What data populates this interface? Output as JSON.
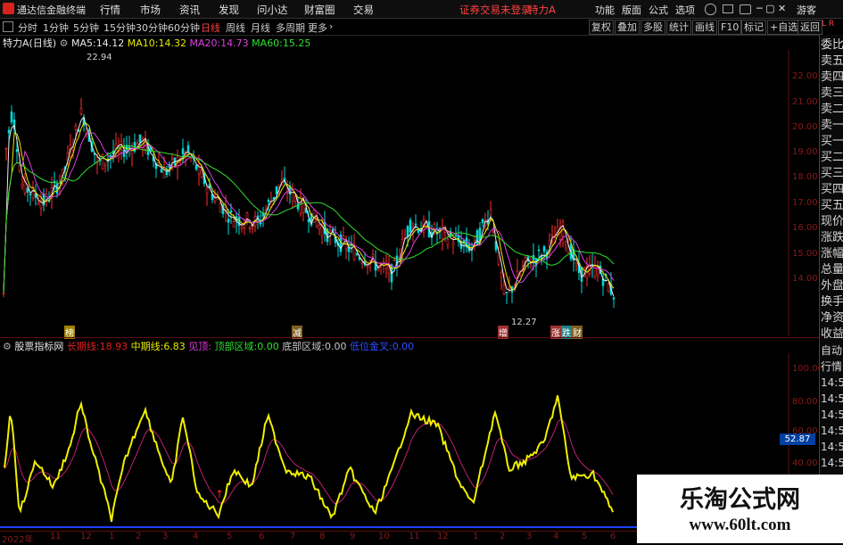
{
  "menubar": {
    "app_title": "通达信金融终端",
    "items": [
      "行情",
      "市场",
      "资讯",
      "发现",
      "问小达",
      "财富圈",
      "交易"
    ],
    "notice": "证券交易未登录",
    "stock_name": "特力A",
    "right_items": [
      "功能",
      "版面",
      "公式",
      "选项"
    ],
    "guest": "游客"
  },
  "toolbar": {
    "periods": [
      "分时",
      "1分钟",
      "5分钟",
      "15分钟",
      "30分钟",
      "60分钟",
      "日线",
      "周线",
      "月线",
      "多周期",
      "更多"
    ],
    "active_period": "日线",
    "right_buttons": [
      "复权",
      "叠加",
      "多股",
      "统计",
      "画线",
      "F10",
      "标记",
      "+自选",
      "返回"
    ]
  },
  "legend_main": {
    "name": "特力A",
    "period": "(日线)",
    "ma": [
      {
        "label": "MA5:",
        "value": "14.12",
        "color": "#e8e8e8"
      },
      {
        "label": "MA10:",
        "value": "14.32",
        "color": "#e8e800"
      },
      {
        "label": "MA20:",
        "value": "14.73",
        "color": "#e040e0"
      },
      {
        "label": "MA60:",
        "value": "15.25",
        "color": "#30e030"
      }
    ]
  },
  "legend_indicator": {
    "name": "股票指标网",
    "items": [
      {
        "label": "长期线:",
        "value": "18.93",
        "color": "#e02020"
      },
      {
        "label": "中期线:",
        "value": "6.83",
        "color": "#e8e800"
      },
      {
        "label": "见顶:",
        "value": "",
        "color": "#e040e0"
      },
      {
        "label": "顶部区域:",
        "value": "0.00",
        "color": "#30e030"
      },
      {
        "label": "底部区域:",
        "value": "0.00",
        "color": "#c8c8c8"
      },
      {
        "label": "低位金叉:",
        "value": "0.00",
        "color": "#3050ff"
      }
    ]
  },
  "price_axis": [
    "22.00",
    "21.00",
    "20.00",
    "19.00",
    "18.00",
    "17.00",
    "16.00",
    "15.00",
    "14.00"
  ],
  "indicator_axis": [
    "100.00",
    "80.00",
    "60.00",
    "40.00"
  ],
  "indicator_current": "52.87",
  "date_axis": [
    "2022年",
    "11",
    "12",
    "1",
    "2",
    "3",
    "4",
    "5",
    "6",
    "7",
    "8",
    "9",
    "10",
    "11",
    "12",
    "1",
    "2",
    "3",
    "4",
    "5",
    "6"
  ],
  "annotations": {
    "high": "22.94",
    "low": "12.27",
    "events": [
      "榜",
      "减",
      "增",
      "涨",
      "跌",
      "财"
    ]
  },
  "sidebar": {
    "top": "L R",
    "items": [
      "委比",
      "卖五",
      "卖四",
      "卖三",
      "卖二",
      "卖一",
      "买一",
      "买二",
      "买三",
      "买四",
      "买五",
      "现价",
      "涨跌",
      "涨幅",
      "总量",
      "外盘",
      "换手",
      "净资",
      "收益"
    ],
    "bottom": [
      "自动",
      "行情",
      "14:5",
      "14:5",
      "14:5",
      "14:5",
      "14:5",
      "14:5",
      "14:5",
      "14:5",
      "14:5"
    ]
  },
  "watermark": {
    "title": "乐淘公式网",
    "url": "www.60lt.com"
  },
  "colors": {
    "up": "#ff3030",
    "down": "#00d8d8",
    "ma5": "#e8e8e8",
    "ma10": "#e8e800",
    "ma20": "#e040e0",
    "ma60": "#30e030",
    "osc": "#f0f000",
    "osc2": "#c02070"
  }
}
